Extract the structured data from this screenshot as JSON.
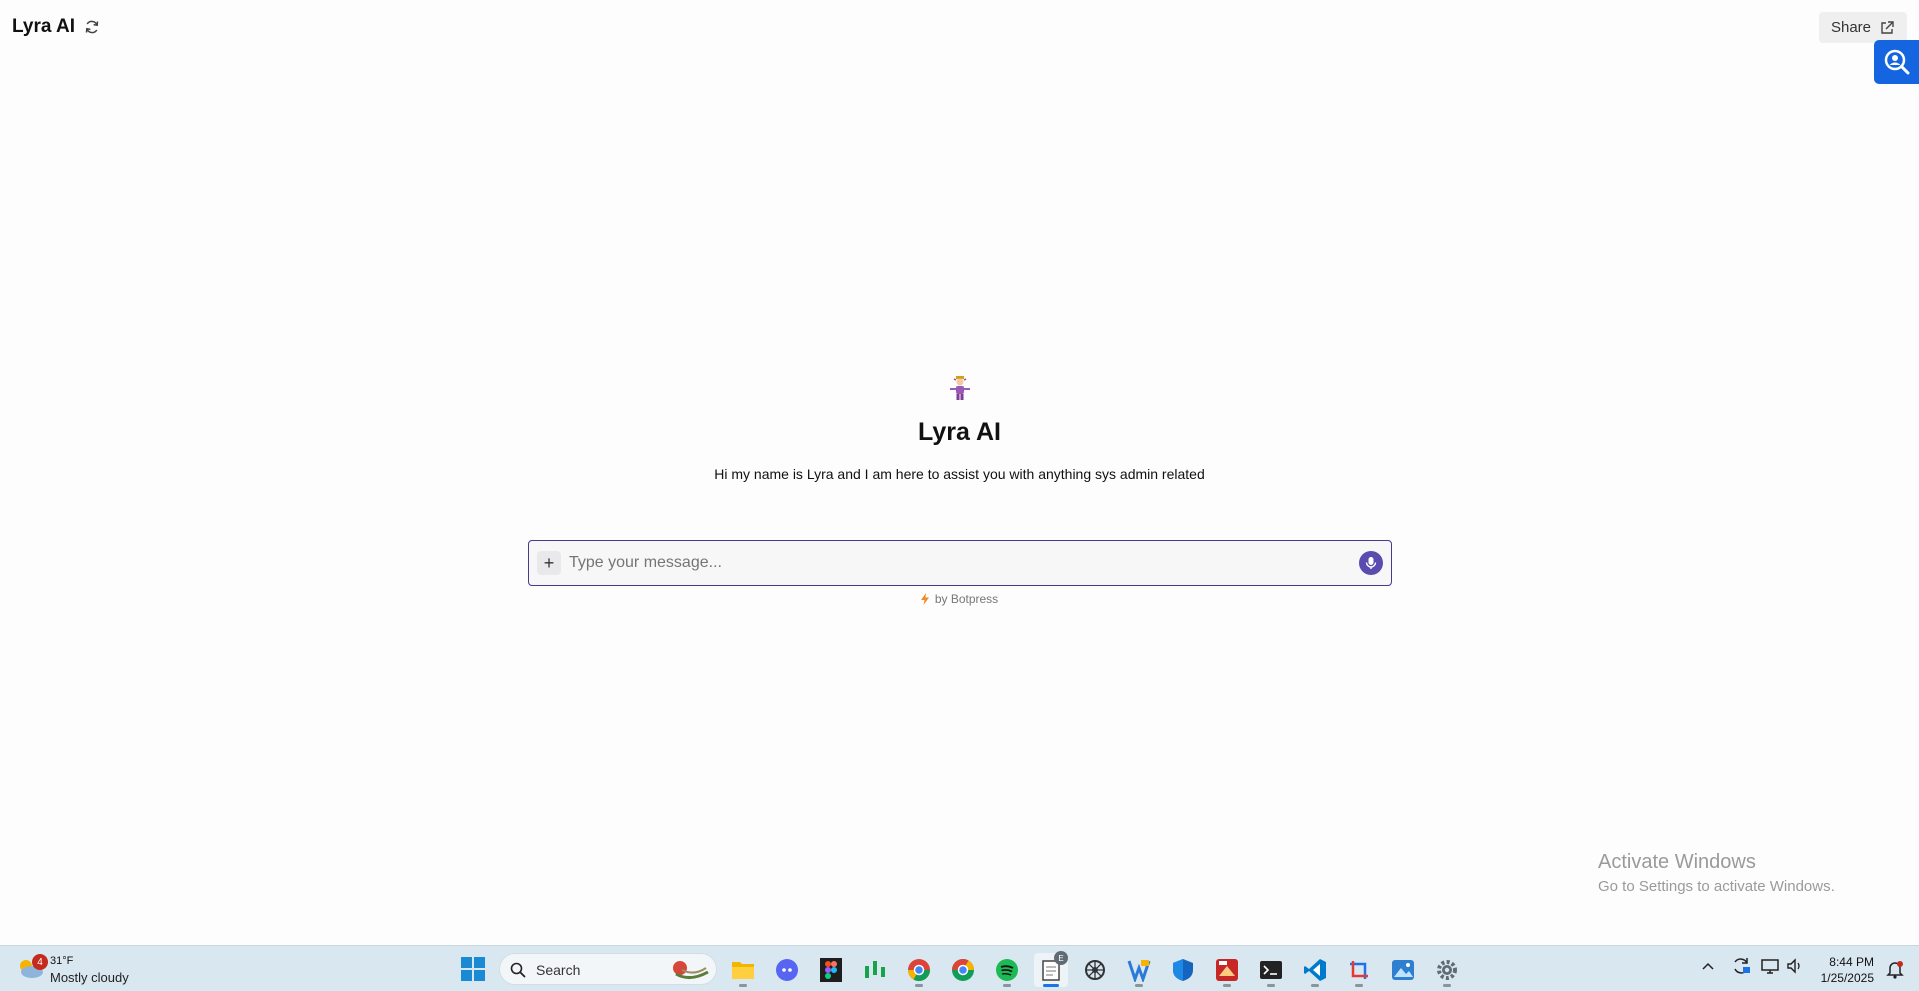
{
  "header": {
    "title": "Lyra AI",
    "share_label": "Share"
  },
  "welcome": {
    "bot_name": "Lyra AI",
    "description": "Hi my name is Lyra and I am here to assist you with anything sys admin related"
  },
  "composer": {
    "placeholder": "Type your message...",
    "attach_symbol": "+",
    "powered_by": "by Botpress"
  },
  "watermark": {
    "title": "Activate Windows",
    "subtitle": "Go to Settings to activate Windows."
  },
  "taskbar": {
    "weather": {
      "temp": "31°F",
      "condition": "Mostly cloudy",
      "badge": "4"
    },
    "search_label": "Search",
    "apps": [
      {
        "name": "file-explorer-icon",
        "color": "#f2b600"
      },
      {
        "name": "discord-icon",
        "color": "#5865f2"
      },
      {
        "name": "figma-icon",
        "color": "#1e1e1e"
      },
      {
        "name": "stock-chart-icon",
        "color": "#16a34a"
      },
      {
        "name": "chrome-profile-icon",
        "color": "#db4437"
      },
      {
        "name": "chrome-icon",
        "color": "#0f9d58"
      },
      {
        "name": "spotify-icon",
        "color": "#1db954"
      },
      {
        "name": "notepad-icon",
        "color": "#444444"
      },
      {
        "name": "settings-wheel-icon",
        "color": "#333333"
      },
      {
        "name": "vs-icon",
        "color": "#2b7bd6"
      },
      {
        "name": "defender-icon",
        "color": "#1565c0"
      },
      {
        "name": "media-app-icon",
        "color": "#c62828"
      },
      {
        "name": "terminal-icon",
        "color": "#222222"
      },
      {
        "name": "vscode-icon",
        "color": "#007acc"
      },
      {
        "name": "snipping-tool-icon",
        "color": "#1a73e8"
      },
      {
        "name": "photos-icon",
        "color": "#2f7fd1"
      },
      {
        "name": "settings-icon",
        "color": "#5f6b75"
      }
    ],
    "notepad_badge": "E",
    "time": "8:44 PM",
    "date": "1/25/2025"
  }
}
